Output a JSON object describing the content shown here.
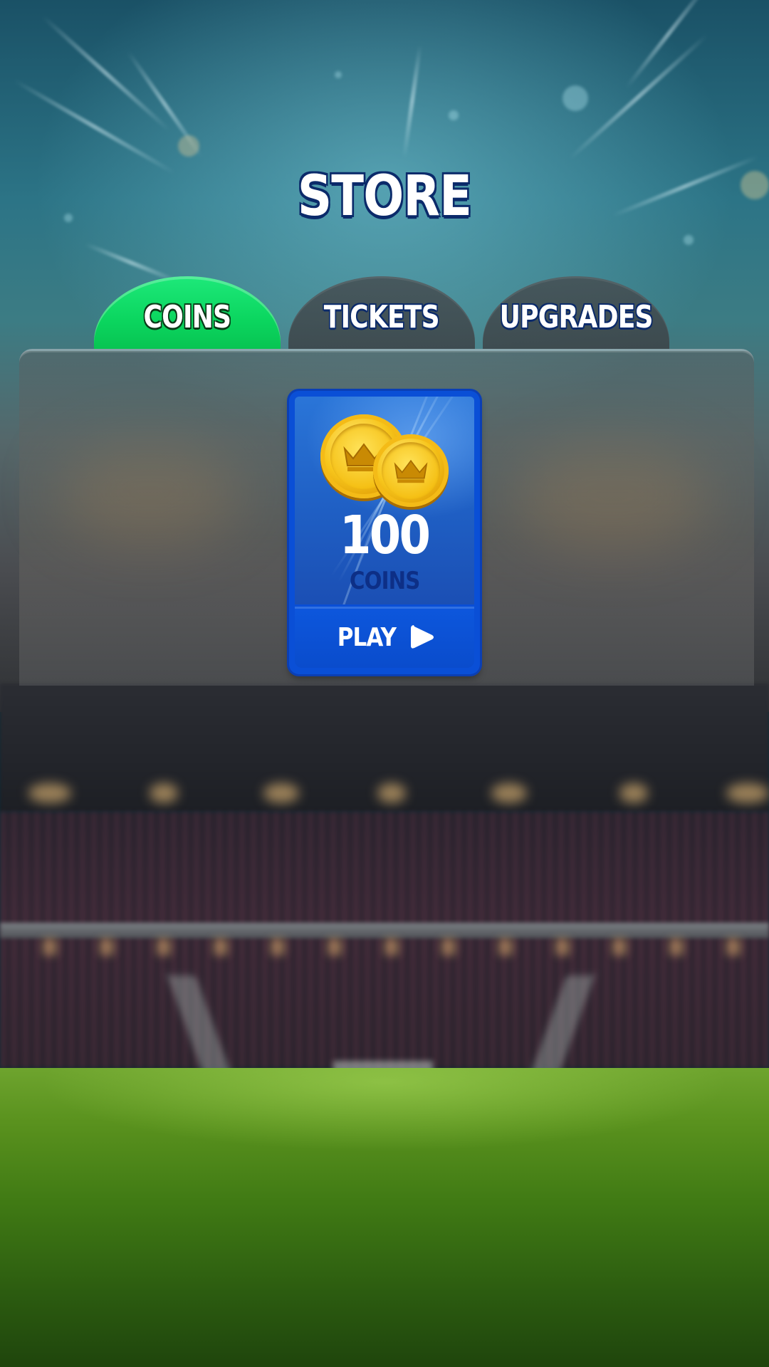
{
  "title": "STORE",
  "tabs": [
    {
      "label": "COINS",
      "active": true
    },
    {
      "label": "TICKETS",
      "active": false
    },
    {
      "label": "UPGRADES",
      "active": false
    }
  ],
  "store_item": {
    "amount": "100",
    "unit": "COINS",
    "icon": "gold-coins-icon",
    "button": {
      "label": "PLAY",
      "icon": "play-icon"
    }
  },
  "colors": {
    "active_tab": "#0bd65f",
    "card": "#0a4fd6",
    "coin": "#f7c61c"
  }
}
